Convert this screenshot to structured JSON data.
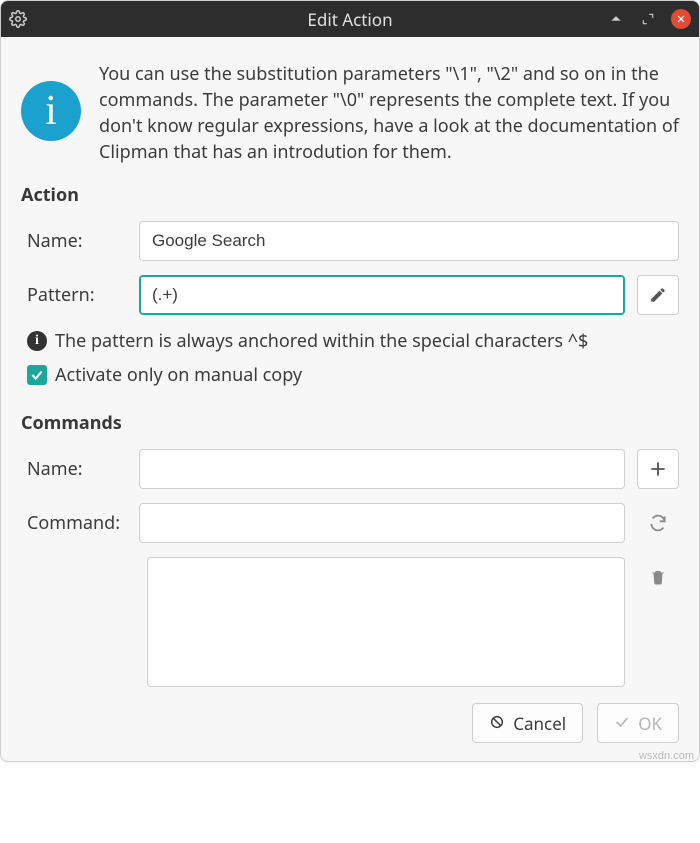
{
  "window": {
    "title": "Edit Action"
  },
  "intro": {
    "text": "You can use the substitution parameters \"\\1\", \"\\2\" and so on in the commands. The parameter \"\\0\" represents the complete text. If you don't know regular expressions, have a look at the documentation of Clipman that has an introdution for them."
  },
  "action": {
    "heading": "Action",
    "name_label": "Name:",
    "name_value": "Google Search",
    "pattern_label": "Pattern:",
    "pattern_value": "(.+)",
    "note": "The pattern is always anchored within the special characters ^$",
    "manual_copy_label": "Activate only on manual copy",
    "manual_copy_checked": true
  },
  "commands": {
    "heading": "Commands",
    "name_label": "Name:",
    "name_value": "",
    "command_label": "Command:",
    "command_value": "",
    "list_value": ""
  },
  "buttons": {
    "cancel": "Cancel",
    "ok": "OK"
  },
  "watermark": "wsxdn.com"
}
